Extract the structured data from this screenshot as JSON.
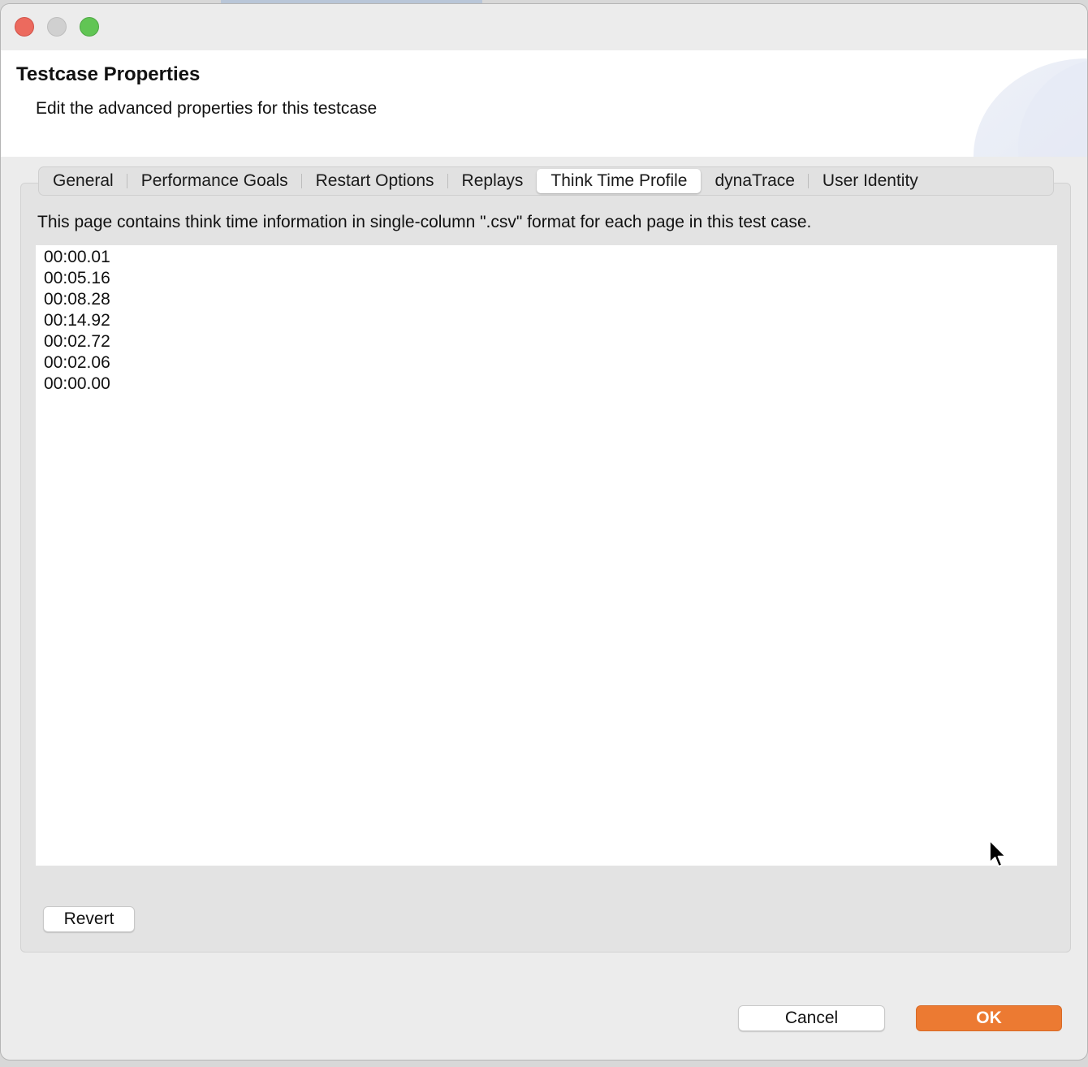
{
  "window": {
    "title": "Testcase Properties",
    "description": "Edit the advanced properties for this testcase"
  },
  "tabs": [
    {
      "label": "General",
      "active": false
    },
    {
      "label": "Performance Goals",
      "active": false
    },
    {
      "label": "Restart Options",
      "active": false
    },
    {
      "label": "Replays",
      "active": false
    },
    {
      "label": "Think Time Profile",
      "active": true
    },
    {
      "label": "dynaTrace",
      "active": false
    },
    {
      "label": "User Identity",
      "active": false
    }
  ],
  "think_time": {
    "info": "This page contains think time information in single-column \".csv\" format for each page in this test case.",
    "lines": [
      "00:00.01",
      "00:05.16",
      "00:08.28",
      "00:14.92",
      "00:02.72",
      "00:02.06",
      "00:00.00"
    ]
  },
  "buttons": {
    "revert": "Revert",
    "cancel": "Cancel",
    "ok": "OK"
  },
  "colors": {
    "accent": "#ec7a32",
    "close": "#ec6a5e",
    "maximize": "#61c554"
  }
}
